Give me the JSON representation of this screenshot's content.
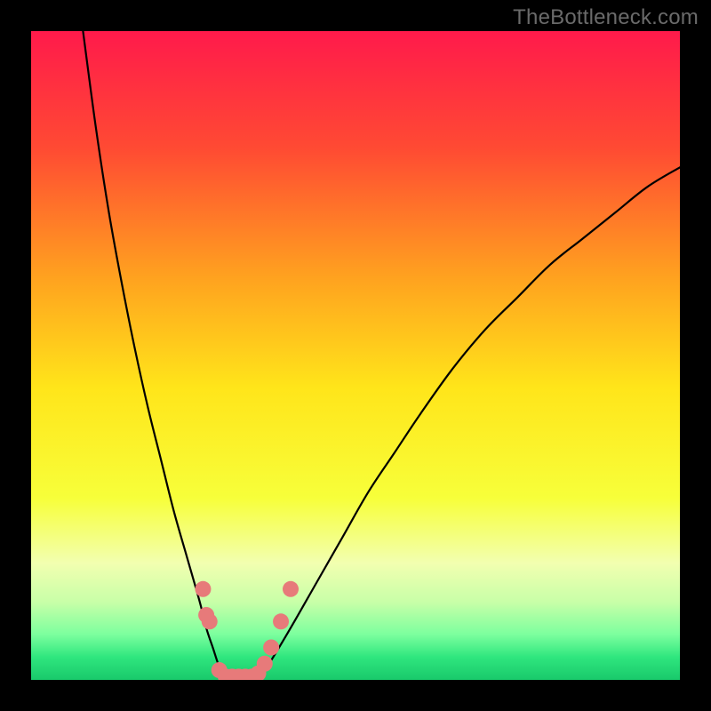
{
  "watermark": "TheBottleneck.com",
  "chart_data": {
    "type": "line",
    "title": "",
    "xlabel": "",
    "ylabel": "",
    "xlim": [
      0,
      100
    ],
    "ylim": [
      0,
      100
    ],
    "gradient_stops": [
      {
        "offset": 0.0,
        "color": "#ff1a4b"
      },
      {
        "offset": 0.18,
        "color": "#ff4a33"
      },
      {
        "offset": 0.38,
        "color": "#ffa21f"
      },
      {
        "offset": 0.55,
        "color": "#ffe51a"
      },
      {
        "offset": 0.72,
        "color": "#f7ff3a"
      },
      {
        "offset": 0.82,
        "color": "#f2ffb0"
      },
      {
        "offset": 0.88,
        "color": "#c8ffa8"
      },
      {
        "offset": 0.93,
        "color": "#7cff9e"
      },
      {
        "offset": 0.965,
        "color": "#2fe67e"
      },
      {
        "offset": 1.0,
        "color": "#19c96b"
      }
    ],
    "series": [
      {
        "name": "left-branch",
        "x": [
          8,
          10,
          12,
          14,
          16,
          18,
          20,
          22,
          24,
          26,
          27,
          28,
          29,
          30
        ],
        "y": [
          100,
          85,
          72,
          61,
          51,
          42,
          34,
          26,
          19,
          12,
          8,
          5,
          2,
          0
        ]
      },
      {
        "name": "valley",
        "x": [
          30,
          31,
          32,
          33,
          34,
          35
        ],
        "y": [
          0,
          0,
          0,
          0,
          0,
          0
        ]
      },
      {
        "name": "right-branch",
        "x": [
          35,
          37,
          40,
          44,
          48,
          52,
          56,
          60,
          65,
          70,
          75,
          80,
          85,
          90,
          95,
          100
        ],
        "y": [
          0,
          3,
          8,
          15,
          22,
          29,
          35,
          41,
          48,
          54,
          59,
          64,
          68,
          72,
          76,
          79
        ]
      }
    ],
    "markers": {
      "name": "sample-dots",
      "color": "#e77a7a",
      "radius": 9,
      "points": [
        {
          "x": 26.5,
          "y": 14
        },
        {
          "x": 27.0,
          "y": 10
        },
        {
          "x": 27.5,
          "y": 9
        },
        {
          "x": 29.0,
          "y": 1.5
        },
        {
          "x": 30.0,
          "y": 0.5
        },
        {
          "x": 31.0,
          "y": 0.5
        },
        {
          "x": 32.0,
          "y": 0.5
        },
        {
          "x": 33.0,
          "y": 0.5
        },
        {
          "x": 34.0,
          "y": 0.5
        },
        {
          "x": 35.0,
          "y": 1.0
        },
        {
          "x": 36.0,
          "y": 2.5
        },
        {
          "x": 37.0,
          "y": 5.0
        },
        {
          "x": 38.5,
          "y": 9.0
        },
        {
          "x": 40.0,
          "y": 14.0
        }
      ]
    }
  }
}
